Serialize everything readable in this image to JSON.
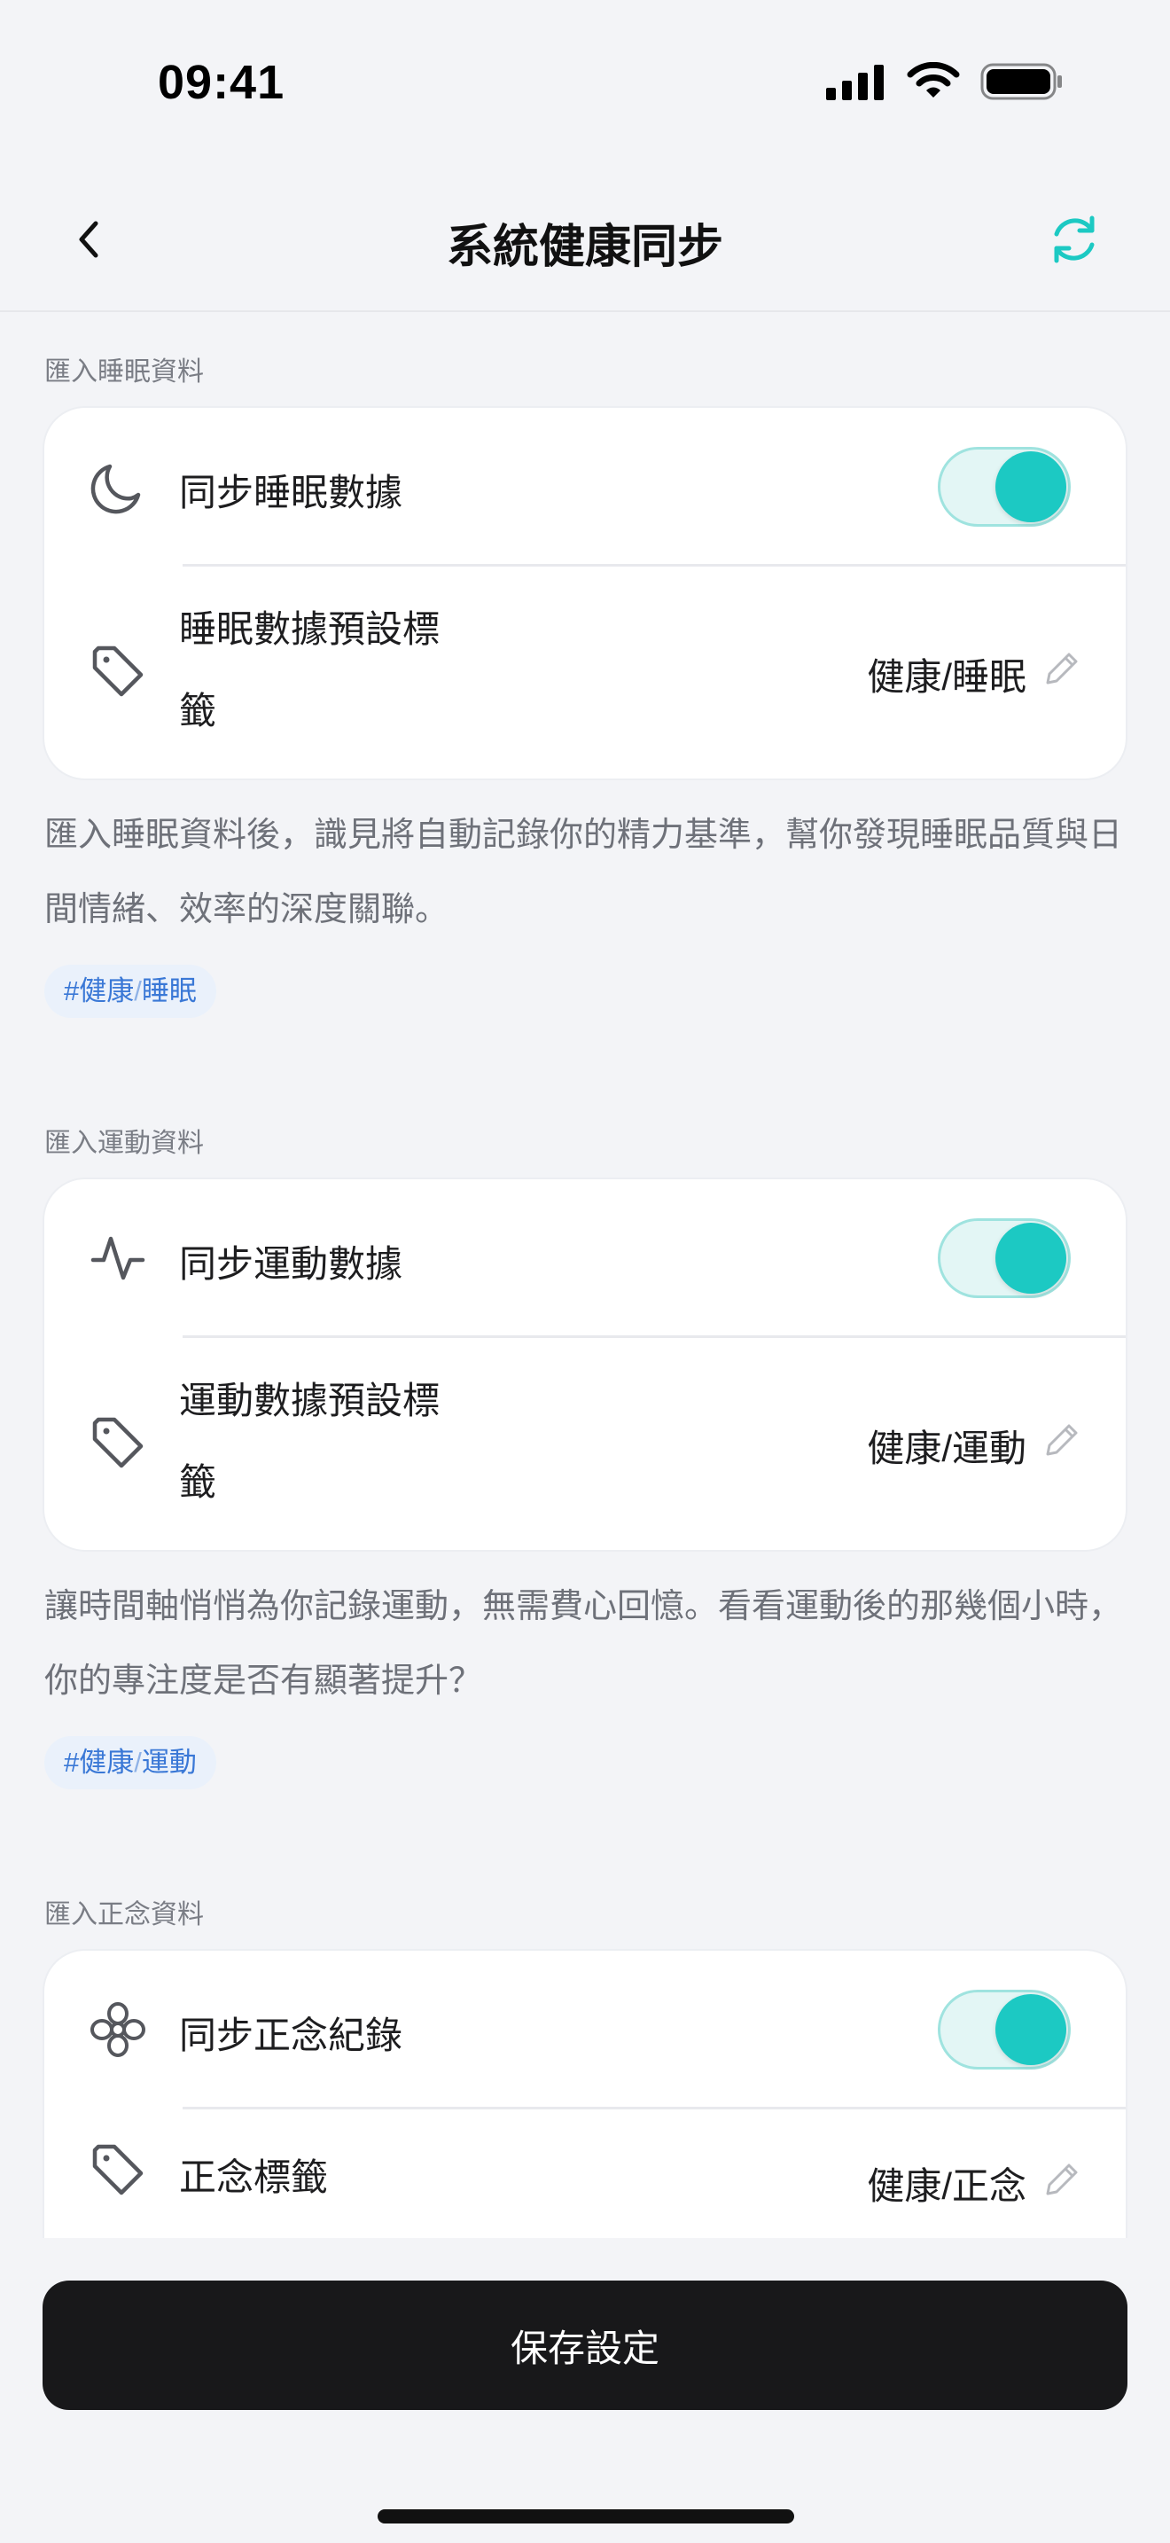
{
  "status_bar": {
    "time": "09:41"
  },
  "nav": {
    "title": "系統健康同步"
  },
  "sections": [
    {
      "label": "匯入睡眠資料",
      "toggle_label": "同步睡眠數據",
      "toggle_on": true,
      "icon": "moon-icon",
      "tag_label": "睡眠數據預設標籤",
      "tag_label_line1": "睡眠數據預設標",
      "tag_label_line2": "籤",
      "tag_value": "健康/睡眠",
      "description": "匯入睡眠資料後，識見將自動記錄你的精力基準，幫你發現睡眠品質與日間情緒、效率的深度關聯。",
      "hashtag_prefix": "#健康",
      "hashtag_sep": "/",
      "hashtag_tail": "睡眠"
    },
    {
      "label": "匯入運動資料",
      "toggle_label": "同步運動數據",
      "toggle_on": true,
      "icon": "activity-icon",
      "tag_label": "運動數據預設標籤",
      "tag_label_line1": "運動數據預設標",
      "tag_label_line2": "籤",
      "tag_value": "健康/運動",
      "description": "讓時間軸悄悄為你記錄運動，無需費心回憶。看看運動後的那幾個小時，你的專注度是否有顯著提升？",
      "hashtag_prefix": "#健康",
      "hashtag_sep": "/",
      "hashtag_tail": "運動"
    },
    {
      "label": "匯入正念資料",
      "toggle_label": "同步正念紀錄",
      "toggle_on": true,
      "icon": "flower-icon",
      "tag_label": "正念標籤",
      "tag_value": "健康/正念"
    }
  ],
  "save_button": {
    "label": "保存設定"
  },
  "colors": {
    "accent": "#1cc9c3",
    "hashtag": "#3a78d6",
    "button": "#18181a"
  }
}
